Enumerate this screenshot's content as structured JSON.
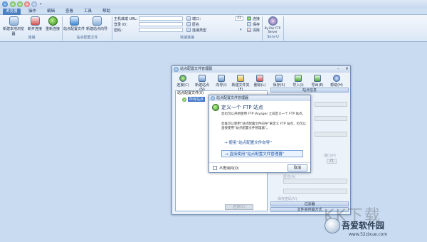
{
  "menu": {
    "items": [
      "浏览器",
      "操作",
      "编辑",
      "查看",
      "工具",
      "帮助"
    ],
    "active": 0
  },
  "ribbon": {
    "buttons": [
      {
        "label": "新建本地浏览器",
        "icon": "new-browser-icon"
      },
      {
        "label": "断开连接",
        "icon": "disconnect-icon"
      },
      {
        "label": "重新连接",
        "icon": "reconnect-icon"
      },
      {
        "label": "站点配置文件",
        "icon": "site-profile-icon"
      },
      {
        "label": "新建站点向导",
        "icon": "site-wizard-icon"
      }
    ],
    "groups": [
      "连接",
      "站点配置文件",
      "快速连接",
      "Serv-U"
    ],
    "fields": {
      "host_label": "主机或或 URL：",
      "user_label": "登录 ID：",
      "pass_label": "密码：",
      "port_label": "端口：",
      "port_value": "21",
      "anon_label": "匿名",
      "conn_type_label": "连接类型",
      "connect_label": "连接",
      "save_label": "保存",
      "clear_label": "清除"
    },
    "servu_label": "By Pair FTP Server"
  },
  "sitemgr": {
    "title": "站点配置文件管理器",
    "toolbar": [
      {
        "label": "连接(C)",
        "icon": "connect-icon"
      },
      {
        "label": "新建站点(N)",
        "icon": "new-site-icon"
      },
      {
        "label": "向导(I)",
        "icon": "wizard-icon"
      },
      {
        "label": "新建文件夹(F)",
        "icon": "new-folder-icon"
      },
      {
        "label": "删除(L)",
        "icon": "delete-icon"
      },
      {
        "label": "保存(S)",
        "icon": "save-icon"
      },
      {
        "label": "导入(I)",
        "icon": "import-icon"
      },
      {
        "label": "导出(E)",
        "icon": "export-icon"
      },
      {
        "label": "帮助(H)",
        "icon": "help-icon"
      }
    ],
    "tree_header": "站点配置文件(0)",
    "tree_root": "所有站点",
    "info_header": "站点信息",
    "port_label": "端口(P)",
    "port_value": "21",
    "anon_label": "匿名(A)",
    "save_pwd_label": "保存密码(V)",
    "filter_header": "过滤器",
    "transfer_header": "文件夹传输方式",
    "apply_label": "连接(C)"
  },
  "modal": {
    "title": "站点配置文件管理器",
    "heading": "定义一个 FTP 站点",
    "body_1": "您也可以开始使用 FTP Voyager 之前定义一个 FTP 站点。",
    "body_2": "您既可以使用“站点配置文件向导”来定义 FTP 站点，也可以直接使用“站点配置文件管理器”。",
    "link_wizard": "→ 使用“站点配置文件向导”",
    "link_direct": "→ 直接使用“站点配置文件管理器”",
    "dont_show": "不再询问(D)",
    "cancel": "取消"
  },
  "watermark": {
    "text": "KK下载",
    "site": "吾爱软件园",
    "url": "www.52zixue.com"
  }
}
